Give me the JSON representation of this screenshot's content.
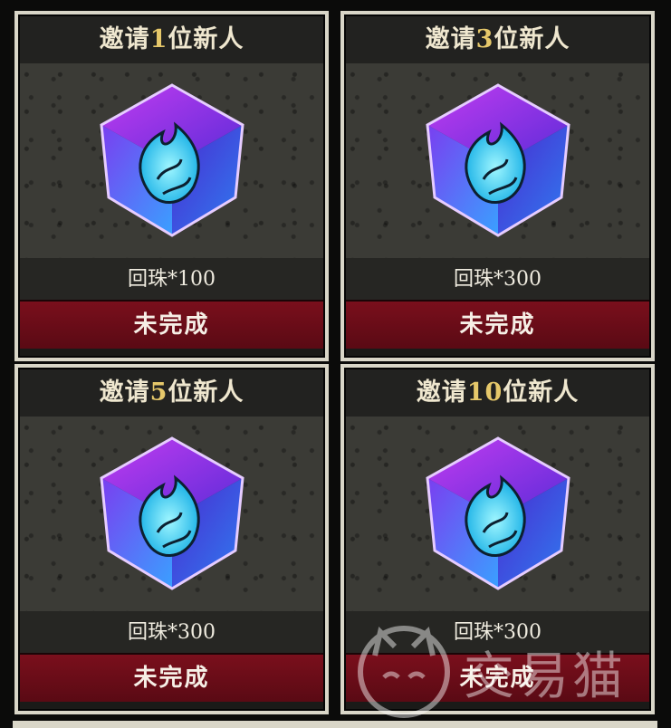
{
  "cards": [
    {
      "title_prefix": "邀请",
      "title_num": "1",
      "title_suffix": "位新人",
      "reward": "回珠*100",
      "status": "未完成"
    },
    {
      "title_prefix": "邀请",
      "title_num": "3",
      "title_suffix": "位新人",
      "reward": "回珠*300",
      "status": "未完成"
    },
    {
      "title_prefix": "邀请",
      "title_num": "5",
      "title_suffix": "位新人",
      "reward": "回珠*300",
      "status": "未完成"
    },
    {
      "title_prefix": "邀请",
      "title_num": "10",
      "title_suffix": "位新人",
      "reward": "回珠*300",
      "status": "未完成"
    }
  ],
  "reward_icon": "crystal-cube-icon",
  "watermark": {
    "text": "交易猫",
    "icon": "cat-logo-icon"
  },
  "colors": {
    "accent_number": "#e6c86a",
    "status_bg": "#7a0f1c",
    "card_border": "#d9d6c8"
  }
}
